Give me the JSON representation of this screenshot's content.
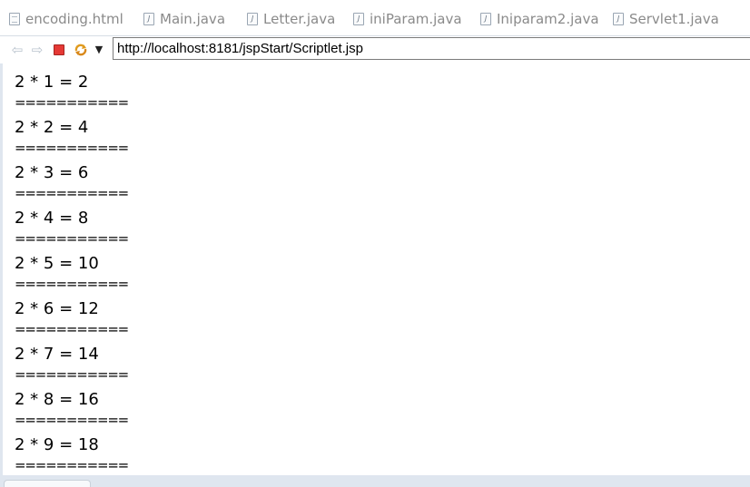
{
  "tabs": [
    {
      "label": "encoding.html",
      "icon": "html-file-icon"
    },
    {
      "label": "Main.java",
      "icon": "java-file-icon"
    },
    {
      "label": "Letter.java",
      "icon": "java-file-icon"
    },
    {
      "label": "iniParam.java",
      "icon": "java-file-icon"
    },
    {
      "label": "Iniparam2.java",
      "icon": "java-file-icon"
    },
    {
      "label": "Servlet1.java",
      "icon": "java-file-icon"
    }
  ],
  "toolbar": {
    "back_icon": "⇦",
    "forward_icon": "⇨",
    "stop_color": "#e53935",
    "refresh_icon": "refresh-icon",
    "menu_icon": "▼",
    "url": "http://localhost:8181/jspStart/Scriptlet.jsp"
  },
  "content": {
    "lines": [
      "2 * 1 = 2",
      "2 * 2 = 4",
      "2 * 3 = 6",
      "2 * 4 = 8",
      "2 * 5 = 10",
      "2 * 6 = 12",
      "2 * 7 = 14",
      "2 * 8 = 16",
      "2 * 9 = 18"
    ],
    "separator": "==========="
  },
  "colors": {
    "tab_text": "#8a8a8a",
    "frame_bg": "#dfe6ef"
  }
}
